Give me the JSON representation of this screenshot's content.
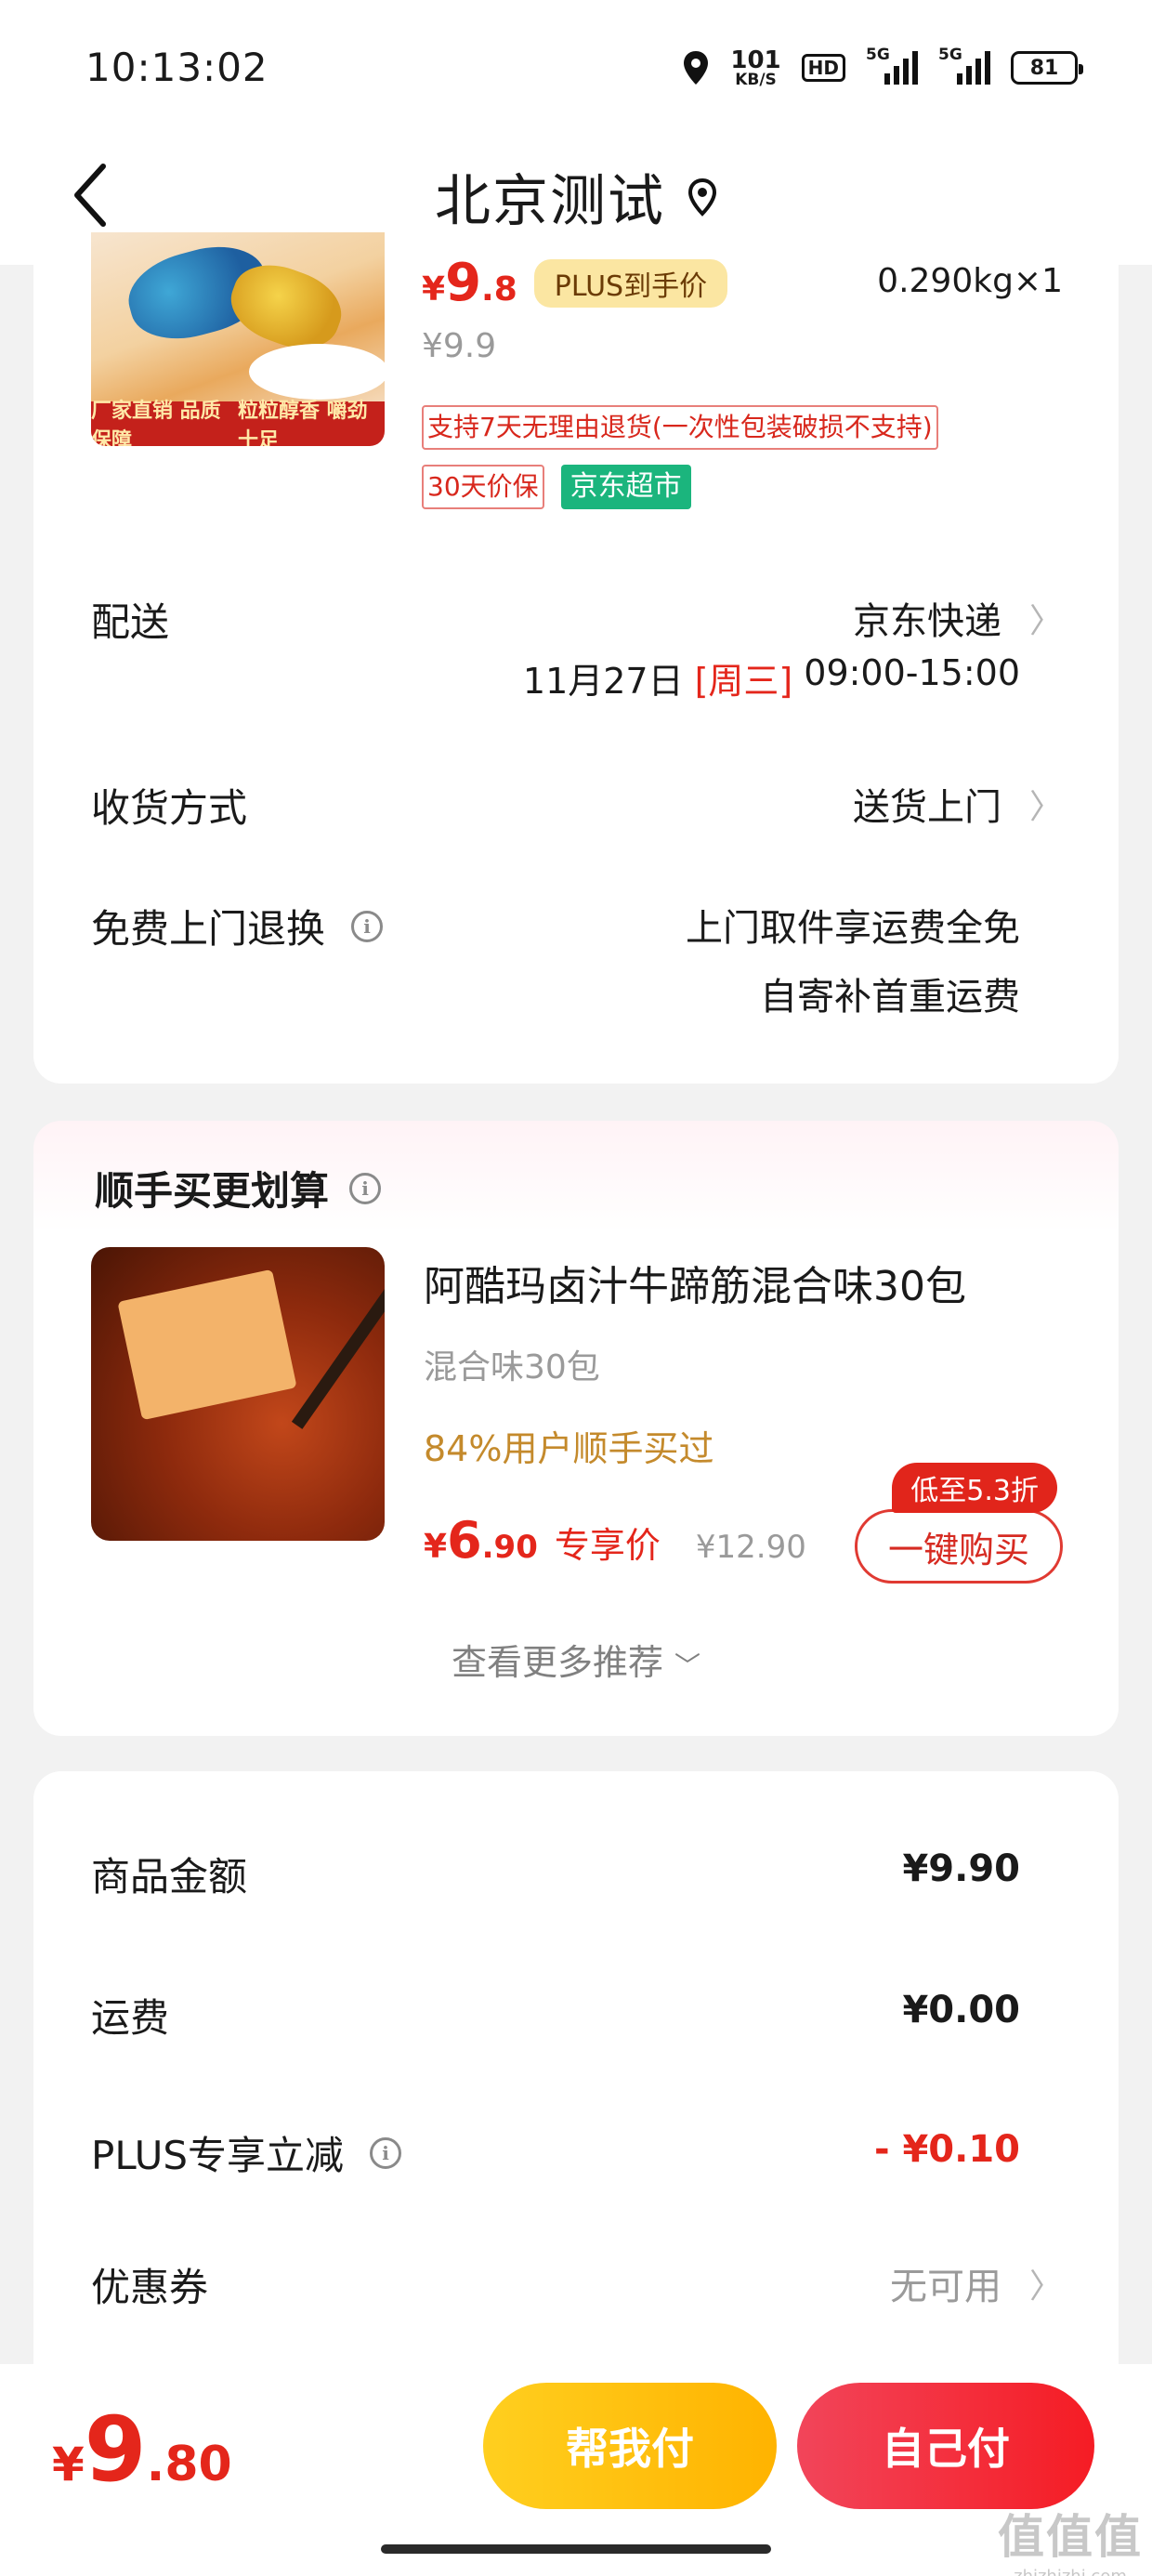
{
  "status_bar": {
    "time": "10:13:02",
    "speed_value": "101",
    "speed_unit": "KB/S",
    "hd_label": "HD",
    "net1_label": "5G",
    "net2_label": "5G",
    "battery": "81"
  },
  "nav": {
    "title": "北京测试",
    "back_icon": "chevron-left-icon",
    "location_icon": "location-pin-icon"
  },
  "main_product": {
    "image_band_left": "厂家直销 品质保障",
    "image_band_right": "粒粒醇香 嚼劲十足",
    "price_symbol": "¥",
    "price_int": "9",
    "price_dec": ".8",
    "plus_tag": "PLUS到手价",
    "weight_qty": "0.290kg×1",
    "orig_price": "¥9.9",
    "return_tag": "支持7天无理由退货(一次性包装破损不支持)",
    "price_protect_tag": "30天价保",
    "store_tag": "京东超市"
  },
  "delivery": {
    "label": "配送",
    "carrier": "京东快递",
    "date_prefix": "11月27日",
    "weekday": "[周三]",
    "time_range": "09:00-15:00"
  },
  "receive_method": {
    "label": "收货方式",
    "value": "送货上门"
  },
  "free_return": {
    "label": "免费上门退换",
    "line1": "上门取件享运费全免",
    "line2": "自寄补首重运费"
  },
  "recommend": {
    "title": "顺手买更划算",
    "product_name": "阿酷玛卤汁牛蹄筋混合味30包",
    "spec": "混合味30包",
    "buy_rate": "84%用户顺手买过",
    "price_symbol": "¥",
    "price_int": "6",
    "price_dec": ".90",
    "price_label": "专享价",
    "orig_price": "¥12.90",
    "discount_badge": "低至5.3折",
    "buy_button": "一键购买",
    "more_link": "查看更多推荐"
  },
  "summary": {
    "goods_amount_label": "商品金额",
    "goods_amount_value": "¥9.90",
    "shipping_label": "运费",
    "shipping_value": "¥0.00",
    "plus_discount_label": "PLUS专享立减",
    "plus_discount_value": "- ¥0.10",
    "coupon_label": "优惠券",
    "coupon_value": "无可用"
  },
  "bottom": {
    "price_symbol": "¥",
    "price_int": "9",
    "price_dec": ".80",
    "help_pay": "帮我付",
    "self_pay": "自己付"
  },
  "watermark": {
    "big": "值值值",
    "small": "zhizhizhi.com"
  },
  "colors": {
    "accent_red": "#e4261b",
    "plus_gold": "#fbe6a2",
    "green_tag": "#1bb57d",
    "help_pay_yellow": "#ffbf0f"
  }
}
